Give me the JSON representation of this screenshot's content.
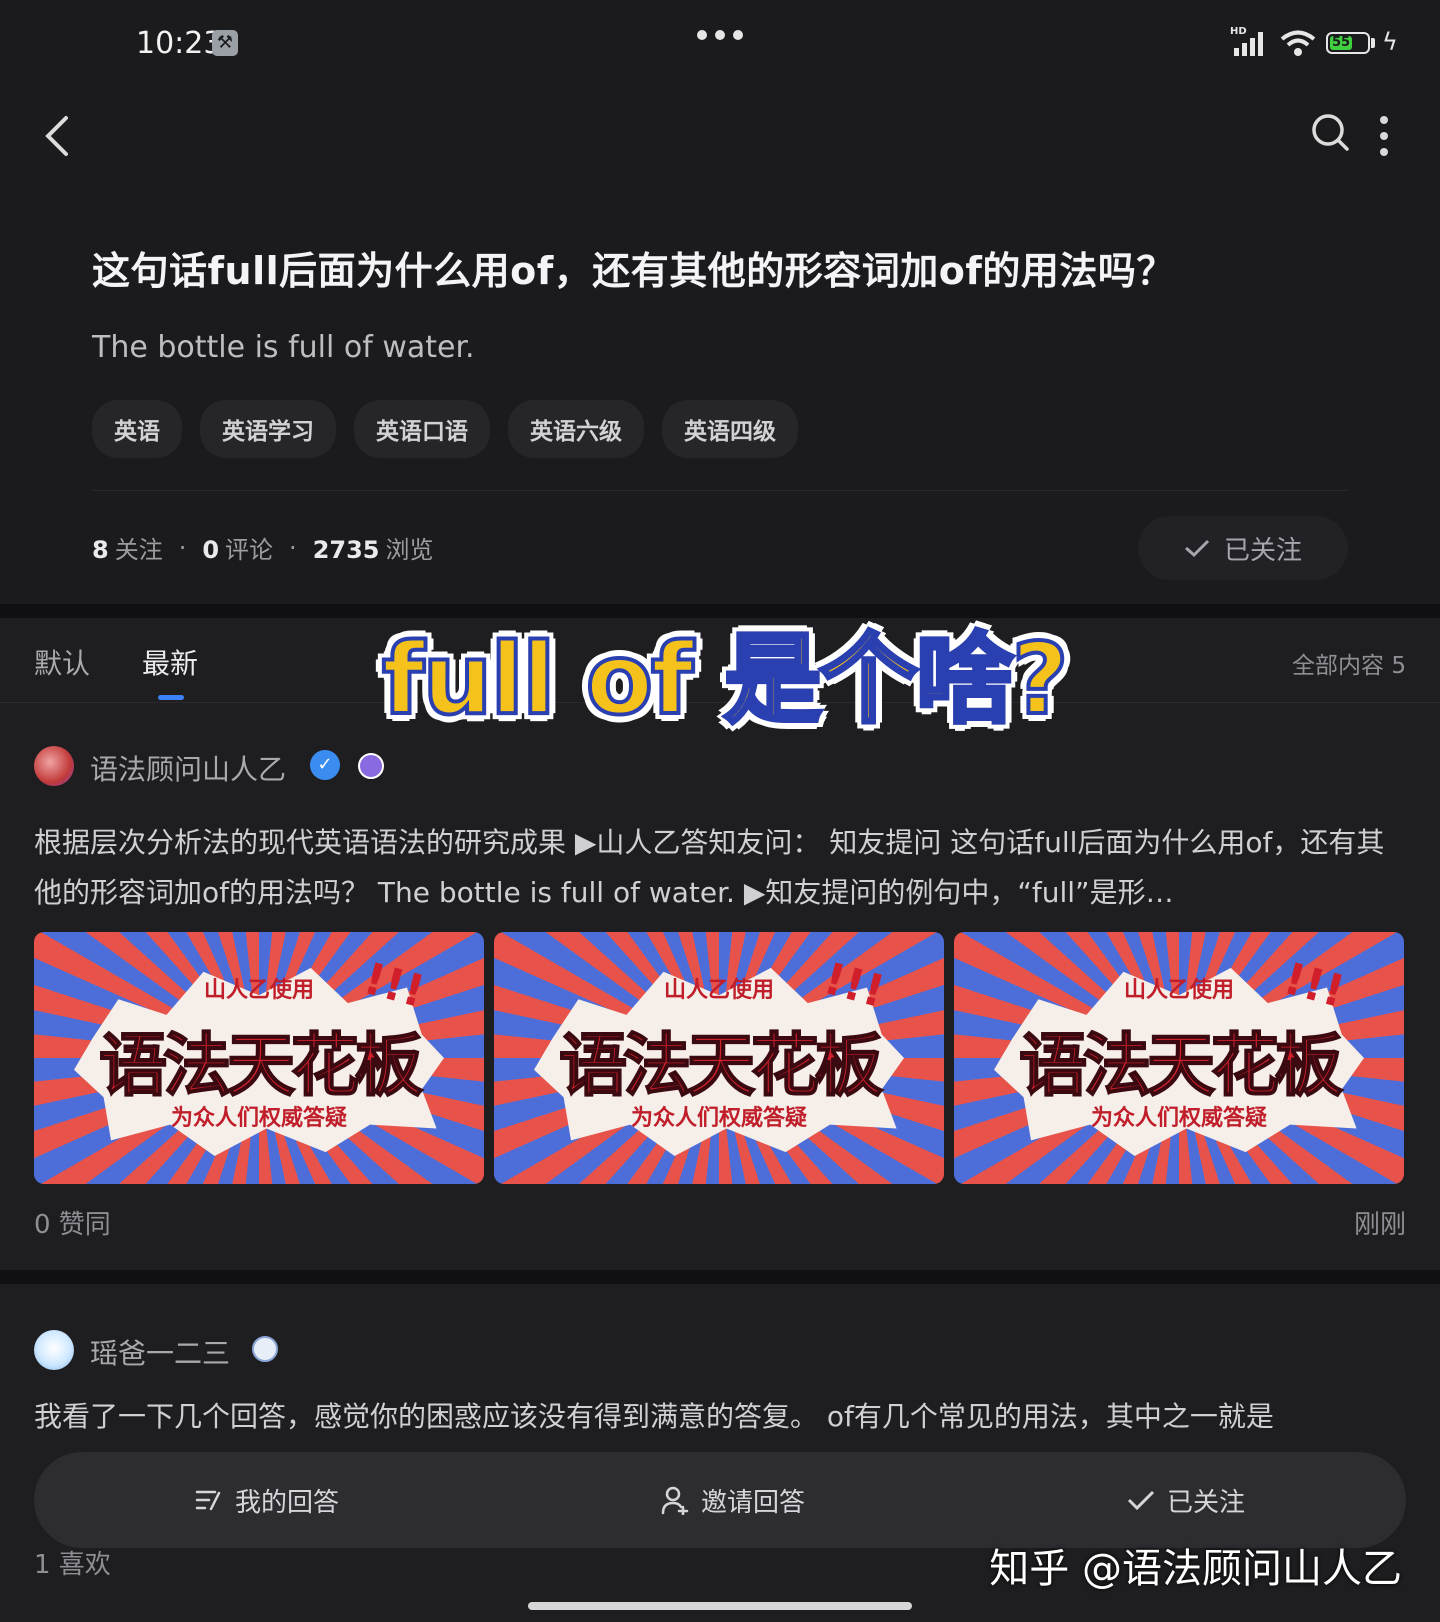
{
  "status_bar": {
    "time": "10:23",
    "battery": "55"
  },
  "question": {
    "title": "这句话full后面为什么用of，还有其他的形容词加of的用法吗？",
    "description": "The bottle is full of water.",
    "tags": [
      "英语",
      "英语学习",
      "英语口语",
      "英语六级",
      "英语四级"
    ],
    "stats": {
      "followers_count": "8",
      "followers_label": "关注",
      "comments_count": "0",
      "comments_label": "评论",
      "views_count": "2735",
      "views_label": "浏览"
    },
    "follow_button": "已关注"
  },
  "tabs": {
    "default": "默认",
    "latest": "最新",
    "all_count": "全部内容 5"
  },
  "overlay_caption": "full of 是个啥?",
  "answers": [
    {
      "author": "语法顾问山人乙",
      "text": "根据层次分析法的现代英语语法的研究成果 ▶山人乙答知友问： 知友提问 这句话full后面为什么用of，还有其他的形容词加of的用法吗？ The bottle is full of water. ▶知友提问的例句中，“full”是形…",
      "thumbnail": {
        "top": "山人乙使用",
        "main": "语法天花板",
        "sub": "为众人们权威答疑",
        "bang": "!!!"
      },
      "votes": "0 赞同",
      "time": "刚刚"
    },
    {
      "author": "瑶爸一二三",
      "text": "我看了一下几个回答，感觉你的困惑应该没有得到满意的答复。 of有几个常见的用法，其中之一就是",
      "likes": "1 喜欢"
    }
  ],
  "bottom_bar": {
    "my_answer": "我的回答",
    "invite": "邀请回答",
    "followed": "已关注"
  },
  "watermark": "知乎 @语法顾问山人乙"
}
